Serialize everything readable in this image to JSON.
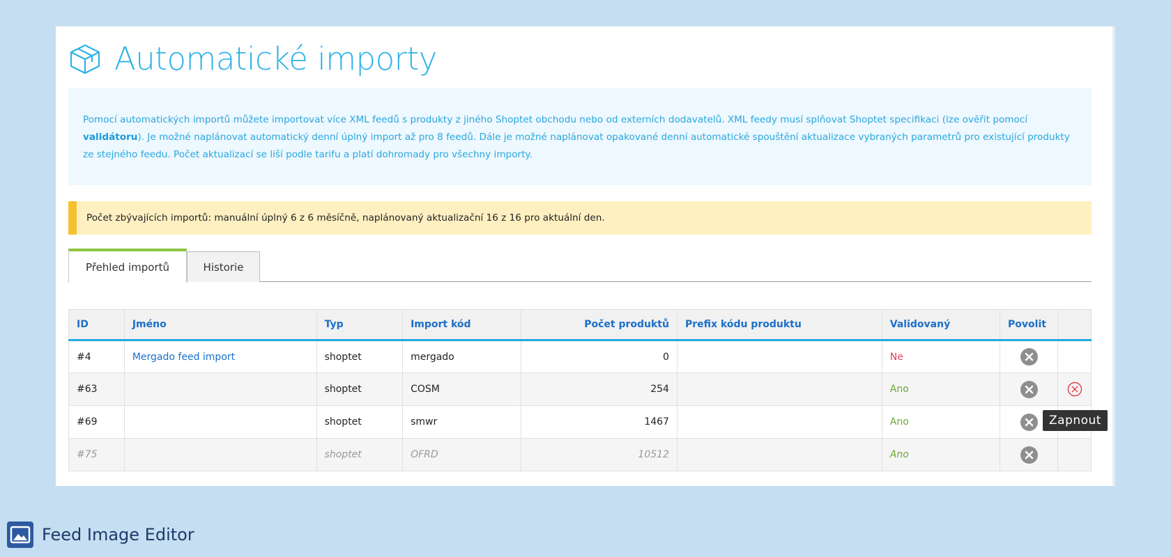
{
  "page": {
    "title": "Automatické importy",
    "title_icon": "package-box-icon"
  },
  "info": {
    "text_before": "Pomocí automatických importů můžete importovat více XML feedů s produkty z jiného Shoptet obchodu nebo od externích dodavatelů. XML feedy musí splňovat Shoptet specifikaci (lze ověřit pomocí ",
    "link": "validátoru",
    "text_after": "). Je možné naplánovat automatický denní úplný import až pro 8 feedů. Dále je možné naplánovat opakované denní automatické spouštění aktualizace vybraných parametrů pro existující produkty ze stejného feedu. Počet aktualizací se liší podle tarifu a platí dohromady pro všechny importy."
  },
  "warning": {
    "text": "Počet zbývajících importů: manuální úplný 6 z 6 měsíčně, naplánovaný aktualizační 16 z 16 pro aktuální den."
  },
  "tabs": [
    {
      "label": "Přehled importů",
      "active": true
    },
    {
      "label": "Historie",
      "active": false
    }
  ],
  "table": {
    "headers": [
      "ID",
      "Jméno",
      "Typ",
      "Import kód",
      "Počet produktů",
      "Prefix kódu produktu",
      "Validovaný",
      "Povolit",
      ""
    ],
    "rows": [
      {
        "id": "#4",
        "name": "Mergado feed import",
        "type": "shoptet",
        "code": "mergado",
        "count": "0",
        "prefix": "",
        "validated": "Ne"
      },
      {
        "id": "#63",
        "name": "",
        "type": "shoptet",
        "code": "COSM",
        "count": "254",
        "prefix": "",
        "validated": "Ano"
      },
      {
        "id": "#69",
        "name": "",
        "type": "shoptet",
        "code": "smwr",
        "count": "1467",
        "prefix": "",
        "validated": "Ano"
      },
      {
        "id": "#75",
        "name": "",
        "type": "shoptet",
        "code": "OFRD",
        "count": "10512",
        "prefix": "",
        "validated": "Ano"
      }
    ]
  },
  "tooltip": {
    "text": "Zapnout"
  },
  "footer": {
    "title": "Feed Image Editor",
    "icon": "image-icon"
  },
  "colors": {
    "accent": "#2eb2e6",
    "link": "#1b6fc8",
    "warning_bar": "#f4c230",
    "tab_active": "#8cc63f",
    "ne": "#e04060",
    "ano": "#6aa83a"
  }
}
